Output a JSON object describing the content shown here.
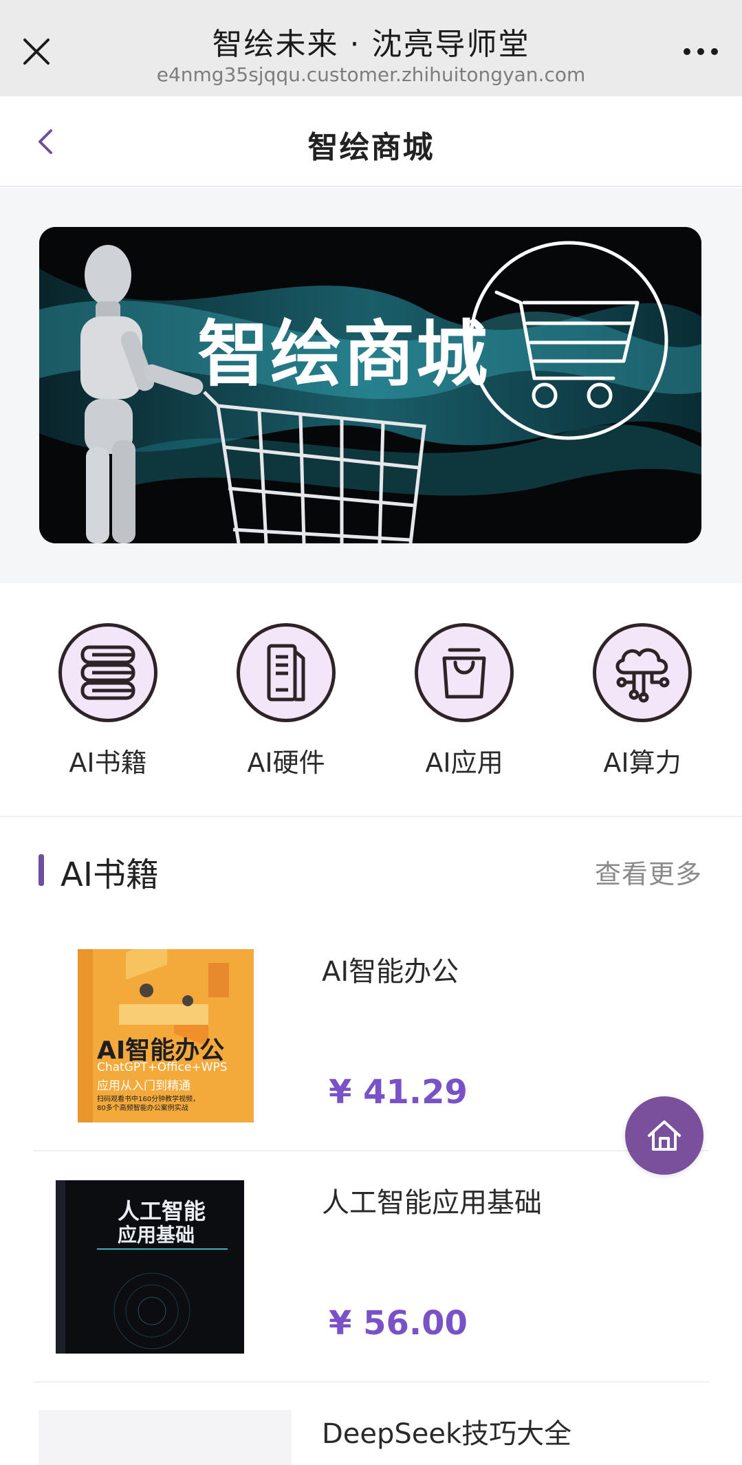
{
  "browser": {
    "title": "智绘未来 · 沈亮导师堂",
    "url": "e4nmg35sjqqu.customer.zhihuitongyan.com"
  },
  "header": {
    "title": "智绘商城"
  },
  "banner": {
    "text": "智绘商城"
  },
  "categories": [
    {
      "label": "AI书籍",
      "icon": "books-icon"
    },
    {
      "label": "AI硬件",
      "icon": "computer-tower-icon"
    },
    {
      "label": "AI应用",
      "icon": "shopping-bag-icon"
    },
    {
      "label": "AI算力",
      "icon": "cloud-network-icon"
    }
  ],
  "section": {
    "title": "AI书籍",
    "more": "查看更多"
  },
  "products": [
    {
      "name": "AI智能办公",
      "price": "¥ 41.29",
      "cover_title": "AI智能办公",
      "cover_subtitle": "ChatGPT+Office+WPS",
      "cover_subtitle2": "应用从入门到精通",
      "cover_note": "扫码观看书中160分钟教学视频，80多个高频智能办公案例实战"
    },
    {
      "name": "人工智能应用基础",
      "price": "¥ 56.00",
      "cover_title": "人工智能",
      "cover_subtitle": "应用基础"
    },
    {
      "name": "DeepSeek技巧大全",
      "price": ""
    }
  ],
  "colors": {
    "accent": "#7a52c7",
    "brand_purple": "#6e4ea0",
    "icon_bg": "#f2e6f8",
    "home_button": "#7a4f9c"
  }
}
